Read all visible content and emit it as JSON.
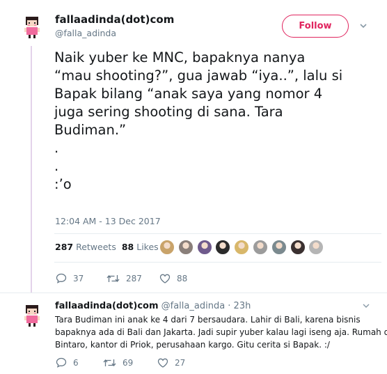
{
  "tweet": {
    "display_name": "fallaadinda(dot)com",
    "handle": "@falla_adinda",
    "follow_label": "Follow",
    "text_lines": [
      "Naik yuber ke MNC, bapaknya nanya",
      "“mau shooting?”, gua jawab “iya..”, lalu si",
      "Bapak bilang “anak saya yang nomor 4",
      "juga sering shooting di sana. Tara",
      "Budiman.”",
      ".",
      ".",
      ":’o"
    ],
    "timestamp": "12:04 AM - 13 Dec 2017",
    "retweets_count": "287",
    "retweets_label": "Retweets",
    "likes_count": "88",
    "likes_label": "Likes",
    "likers": [
      {
        "name": "liker-avatar",
        "color": "#c9a36a"
      },
      {
        "name": "liker-avatar",
        "color": "#8a7f7a"
      },
      {
        "name": "liker-avatar",
        "color": "#6f5a8c"
      },
      {
        "name": "liker-avatar",
        "color": "#2b2b2b"
      },
      {
        "name": "liker-avatar",
        "color": "#d8b76a"
      },
      {
        "name": "liker-avatar",
        "color": "#9c9c9c"
      },
      {
        "name": "liker-avatar",
        "color": "#7b8a8f"
      },
      {
        "name": "liker-avatar",
        "color": "#3a3030"
      },
      {
        "name": "liker-avatar",
        "color": "#b5b5b5"
      }
    ],
    "replies": "37",
    "retweets": "287",
    "likes": "88"
  },
  "reply": {
    "display_name": "fallaadinda(dot)com",
    "handle_time": "@falla_adinda · 23h",
    "text_lines": [
      "Tara Budiman ini anak ke 4 dari 7 bersaudara. Lahir di Bali, karena bisnis",
      "bapaknya ada di Bali dan Jakarta. Jadi supir yuber kalau lagi iseng aja. Rumah di",
      "Bintaro, kantor di Priok, perusahaan kargo. Gitu cerita si Bapak. :/"
    ],
    "replies": "6",
    "retweets": "69",
    "likes": "27"
  },
  "colors": {
    "accent": "#e0245e",
    "muted": "#657786",
    "thread_line": "#e3d3ea"
  },
  "icons": [
    "reply-icon",
    "retweet-icon",
    "like-icon",
    "chevron-down-icon"
  ]
}
